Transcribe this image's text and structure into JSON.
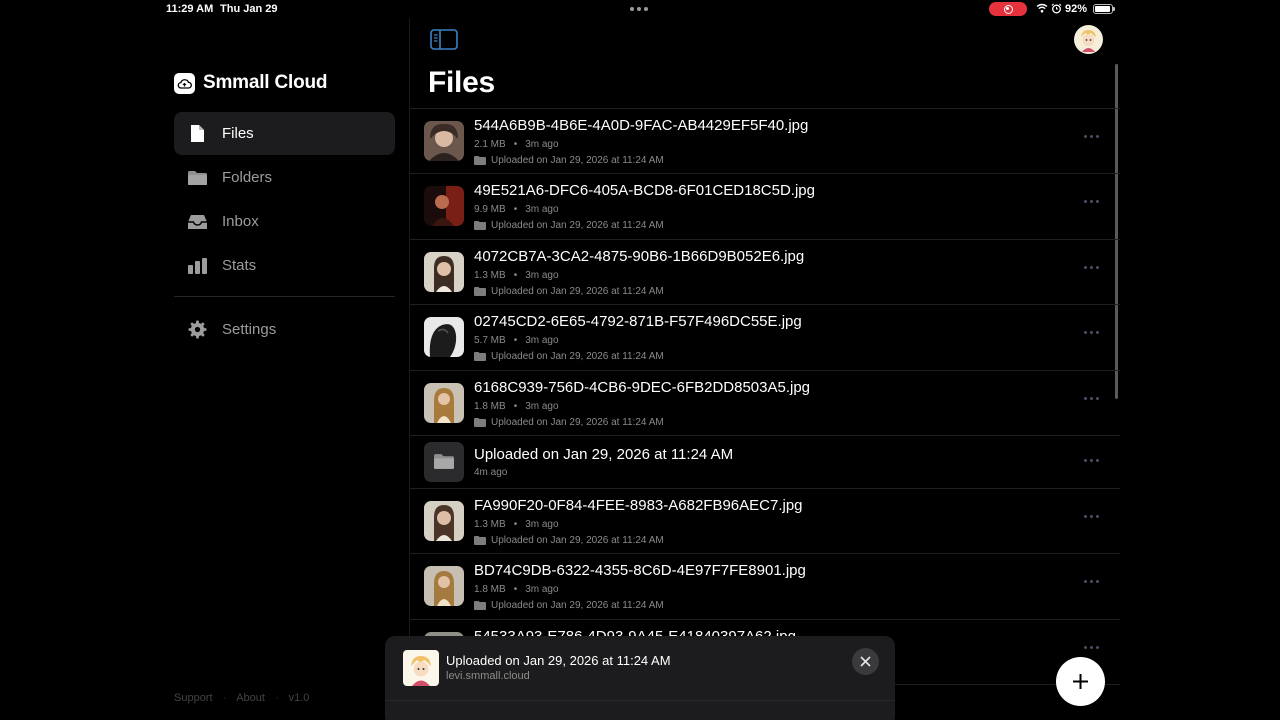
{
  "statusbar": {
    "time": "11:29 AM",
    "date": "Thu Jan 29",
    "battery": "92%",
    "icons": [
      "screen-record-icon",
      "wifi-icon",
      "alarm-icon",
      "battery-icon"
    ]
  },
  "app": {
    "name": "Smmall Cloud",
    "brand_icon": "cloud-icon"
  },
  "sidebar": {
    "items": [
      {
        "label": "Files",
        "icon": "document-icon",
        "active": true
      },
      {
        "label": "Folders",
        "icon": "folder-icon",
        "active": false
      },
      {
        "label": "Inbox",
        "icon": "inbox-icon",
        "active": false
      },
      {
        "label": "Stats",
        "icon": "bar-chart-icon",
        "active": false
      }
    ],
    "settings": {
      "label": "Settings",
      "icon": "gear-icon"
    },
    "footer": {
      "support": "Support",
      "about": "About",
      "version": "v1.0",
      "separator": "·"
    }
  },
  "main": {
    "title": "Files",
    "files": [
      {
        "name": "544A6B9B-4B6E-4A0D-9FAC-AB4429EF5F40.jpg",
        "size": "2.1 MB",
        "age": "3m ago",
        "uploaded": "Uploaded on Jan 29, 2026 at 11:24 AM"
      },
      {
        "name": "49E521A6-DFC6-405A-BCD8-6F01CED18C5D.jpg",
        "size": "9.9 MB",
        "age": "3m ago",
        "uploaded": "Uploaded on Jan 29, 2026 at 11:24 AM"
      },
      {
        "name": "4072CB7A-3CA2-4875-90B6-1B66D9B052E6.jpg",
        "size": "1.3 MB",
        "age": "3m ago",
        "uploaded": "Uploaded on Jan 29, 2026 at 11:24 AM"
      },
      {
        "name": "02745CD2-6E65-4792-871B-F57F496DC55E.jpg",
        "size": "5.7 MB",
        "age": "3m ago",
        "uploaded": "Uploaded on Jan 29, 2026 at 11:24 AM"
      },
      {
        "name": "6168C939-756D-4CB6-9DEC-6FB2DD8503A5.jpg",
        "size": "1.8 MB",
        "age": "3m ago",
        "uploaded": "Uploaded on Jan 29, 2026 at 11:24 AM"
      }
    ],
    "folder": {
      "name": "Uploaded on Jan 29, 2026 at 11:24 AM",
      "age": "4m ago"
    },
    "files_after": [
      {
        "name": "FA990F20-0F84-4FEE-8983-A682FB96AEC7.jpg",
        "size": "1.3 MB",
        "age": "3m ago",
        "uploaded": "Uploaded on Jan 29, 2026 at 11:24 AM"
      },
      {
        "name": "BD74C9DB-6322-4355-8C6D-4E97F7FE8901.jpg",
        "size": "1.8 MB",
        "age": "3m ago",
        "uploaded": "Uploaded on Jan 29, 2026 at 11:24 AM"
      },
      {
        "name": "54533A93-E786-4D93-9A45-E41840397A62.jpg",
        "size": "",
        "age": "",
        "uploaded": ""
      }
    ],
    "meta_separator": "•"
  },
  "toast": {
    "title": "Uploaded on Jan 29, 2026 at 11:24 AM",
    "subtitle": "levi.smmall.cloud"
  },
  "colors": {
    "background": "#000000",
    "sidebar_active": "#1c1c1e",
    "record_badge": "#e5323c",
    "muted_text": "#8a8a8a",
    "accent_dots": "#4a4f63"
  }
}
